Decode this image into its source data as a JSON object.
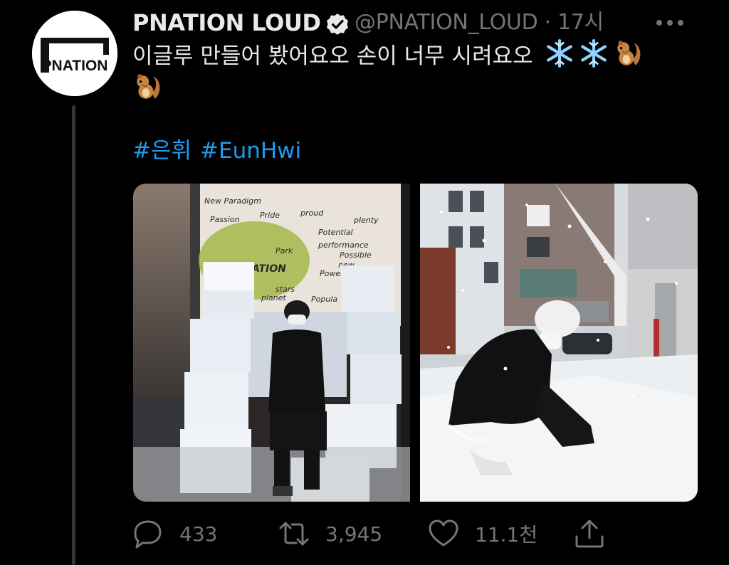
{
  "account": {
    "display_name": "PNATION LOUD",
    "handle_time": "@PNATION_LOUD · 17시",
    "avatar_text": "PNATION"
  },
  "tweet": {
    "text": "이글루 만들어 봤어요오 손이 너무 시려요오",
    "emoji": [
      "snowflake-emoji",
      "snowflake-emoji",
      "chipmunk-emoji",
      "chipmunk-emoji"
    ],
    "hashtags": [
      "#은휘",
      "#EunHwi"
    ]
  },
  "media": {
    "images": [
      "photo-igloo-indoor",
      "photo-snow-outdoor"
    ],
    "whiteboard_words": [
      "New Paradigm",
      "Passion",
      "Pride",
      "proud",
      "Potential",
      "plenty",
      "Park",
      "performance",
      "Possible",
      "PNATION",
      "Power",
      "new",
      "Popula",
      "stars",
      "planet"
    ]
  },
  "actions": {
    "replies": "433",
    "retweets": "3,945",
    "likes": "11.1천"
  },
  "colors": {
    "background": "#000000",
    "text": "#e7e9ea",
    "muted": "#71767b",
    "link": "#1d9bf0"
  }
}
